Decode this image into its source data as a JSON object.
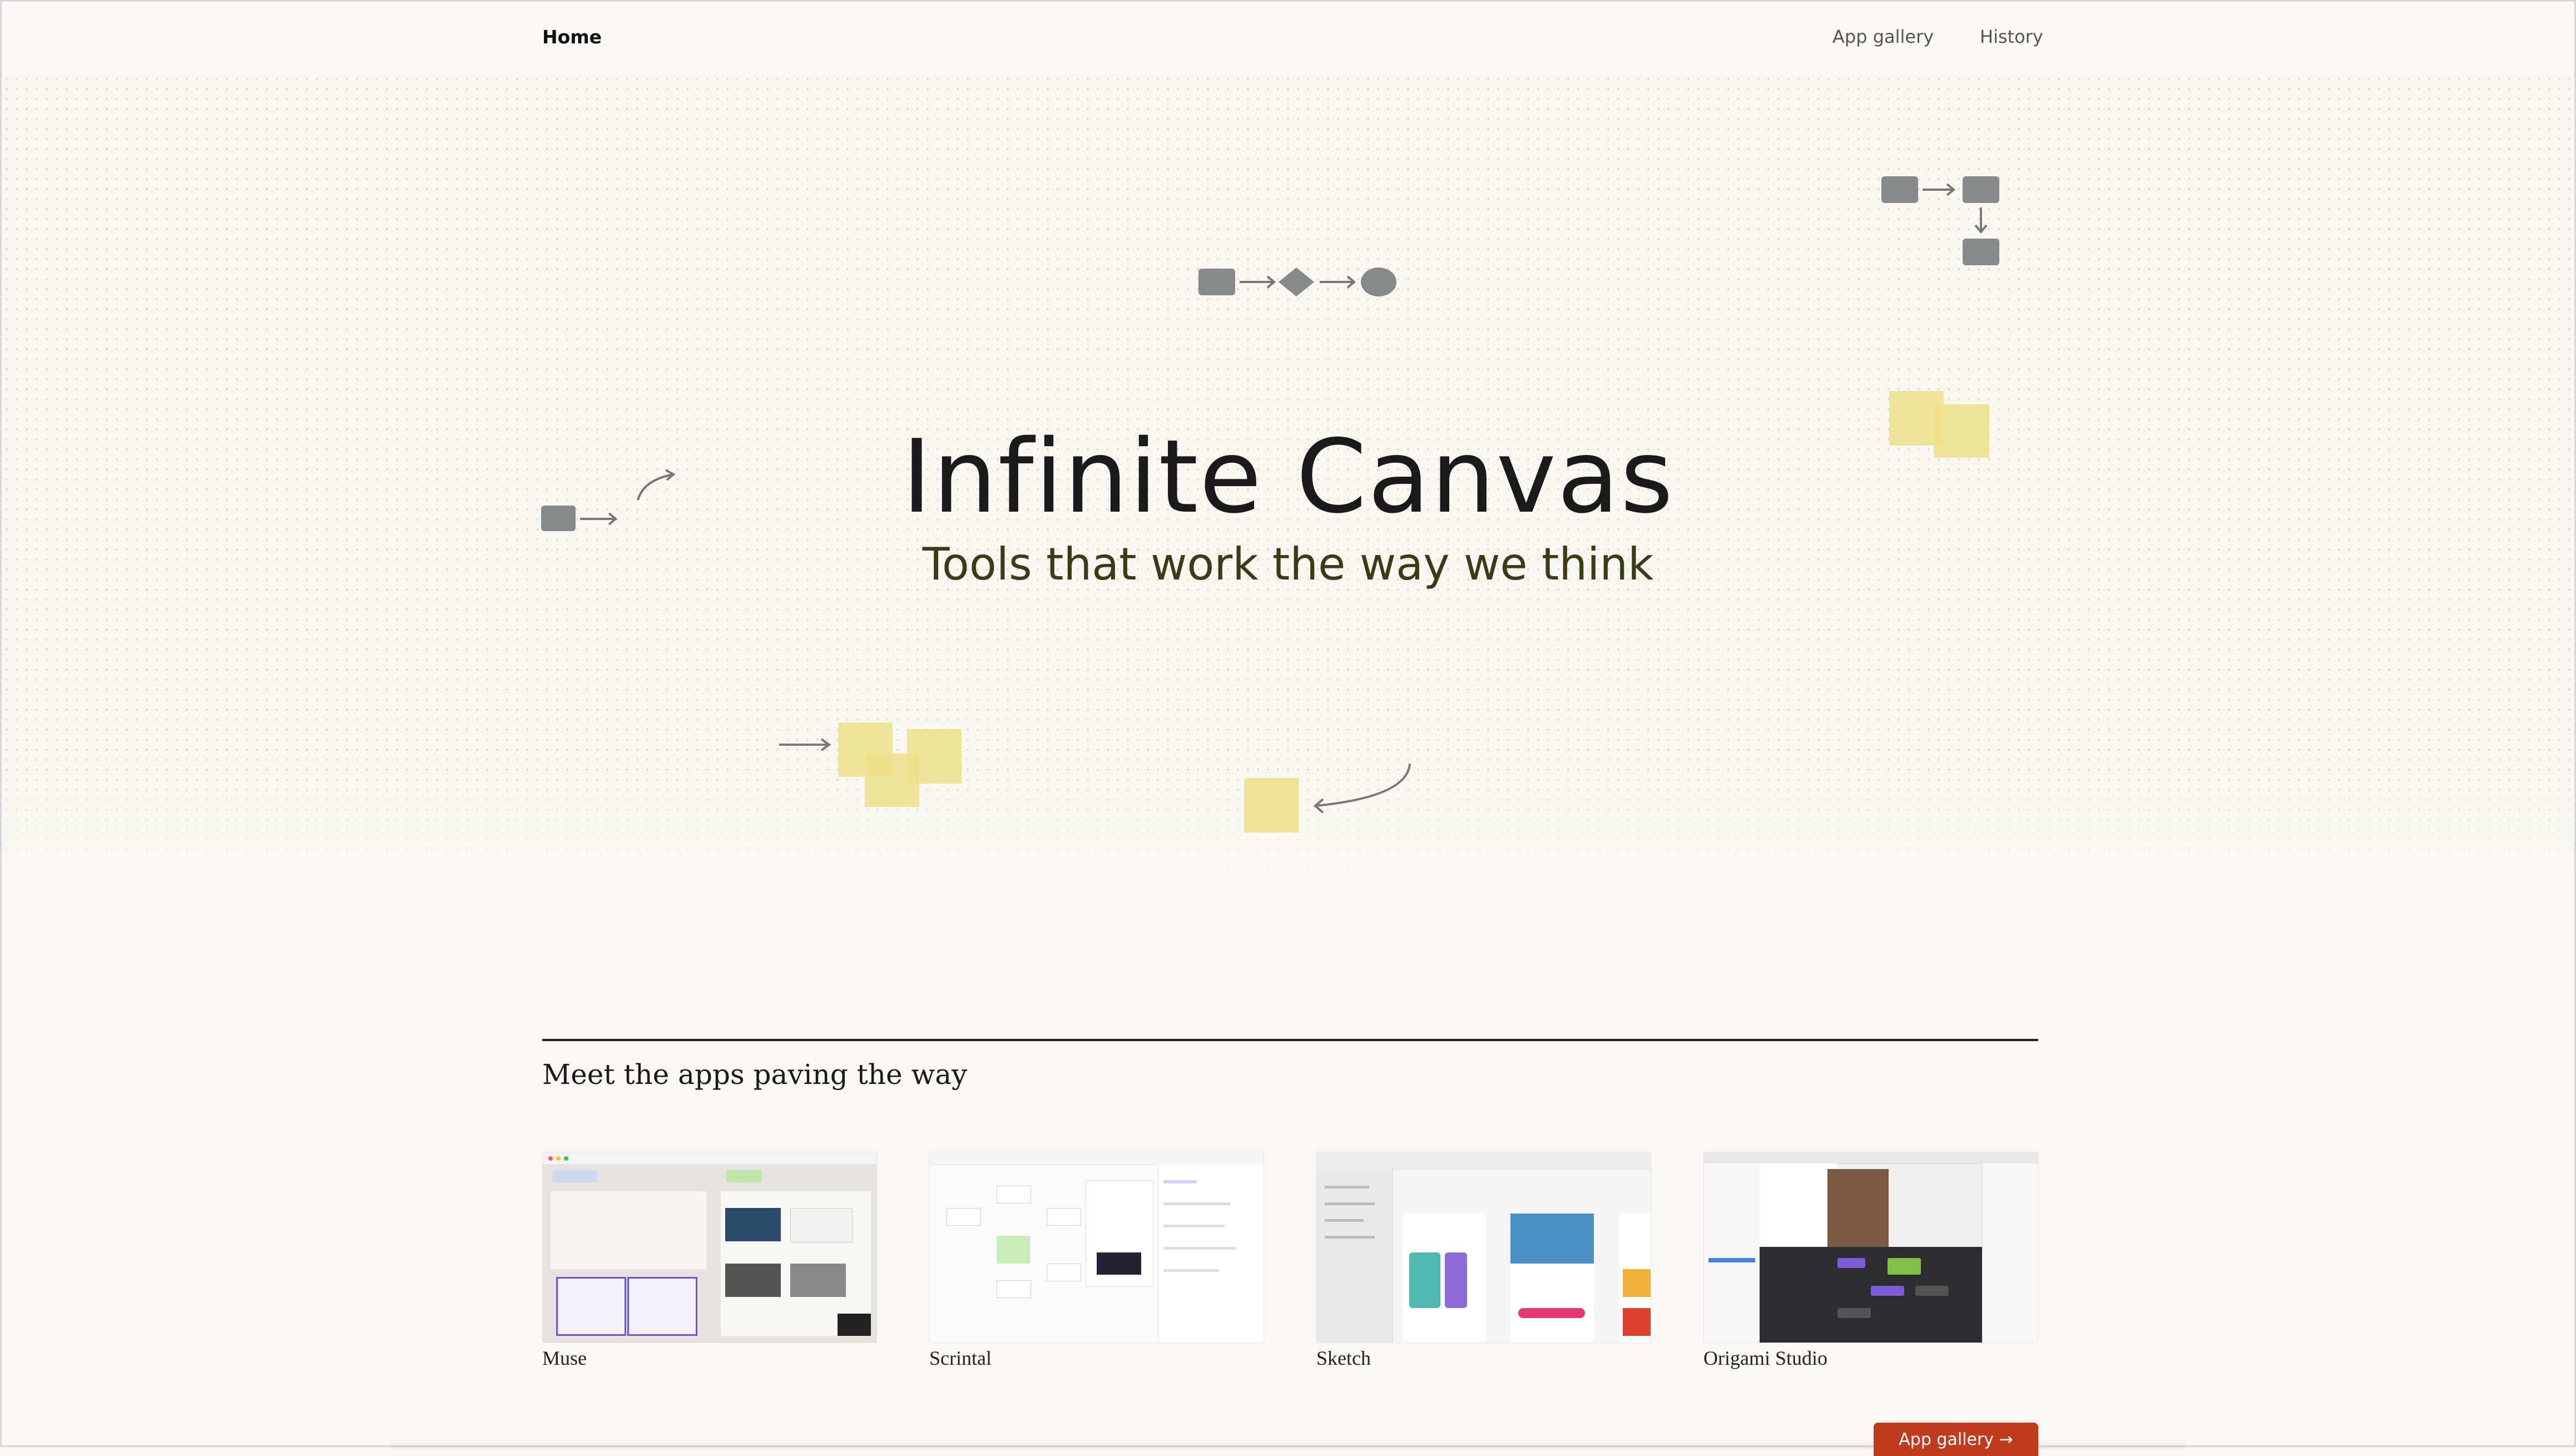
{
  "nav": {
    "home": "Home",
    "links": [
      "App gallery",
      "History"
    ]
  },
  "hero": {
    "title": "Infinite Canvas",
    "subtitle": "Tools that work the way we think"
  },
  "section": {
    "title": "Meet the apps paving the way"
  },
  "apps": [
    {
      "label": "Muse",
      "thumb_icon": "muse-screenshot-thumbnail"
    },
    {
      "label": "Scrintal",
      "thumb_icon": "scrintal-screenshot-thumbnail"
    },
    {
      "label": "Sketch",
      "thumb_icon": "sketch-screenshot-thumbnail"
    },
    {
      "label": "Origami Studio",
      "thumb_icon": "origami-screenshot-thumbnail"
    }
  ],
  "cta": {
    "label": "App gallery →"
  },
  "colors": {
    "background": "#f9f8f4",
    "shape_gray": "#868a88",
    "sticky_yellow": "#efe08a",
    "subtitle": "#3d3b16",
    "cta": "#c23a1e"
  }
}
